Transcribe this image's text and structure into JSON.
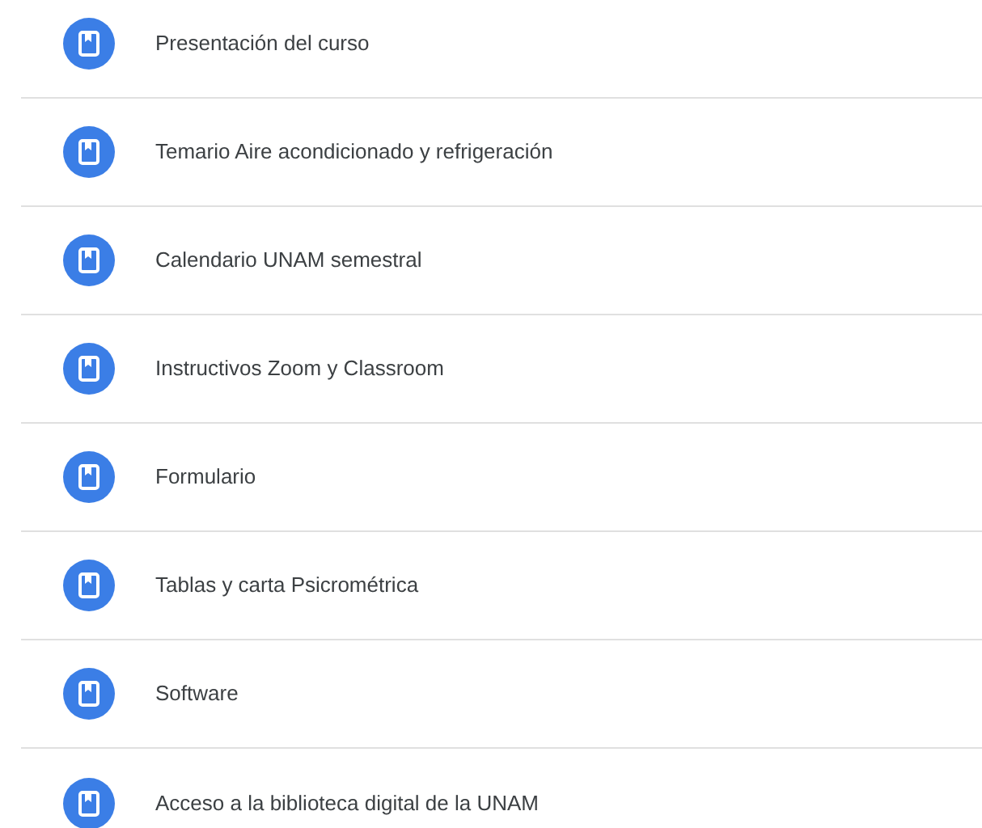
{
  "topics": [
    {
      "title": "Presentación del curso"
    },
    {
      "title": "Temario Aire acondicionado y refrigeración"
    },
    {
      "title": "Calendario UNAM semestral"
    },
    {
      "title": "Instructivos Zoom y Classroom"
    },
    {
      "title": "Formulario"
    },
    {
      "title": "Tablas y carta Psicrométrica"
    },
    {
      "title": "Software"
    },
    {
      "title": "Acceso a la biblioteca digital de la UNAM"
    }
  ]
}
